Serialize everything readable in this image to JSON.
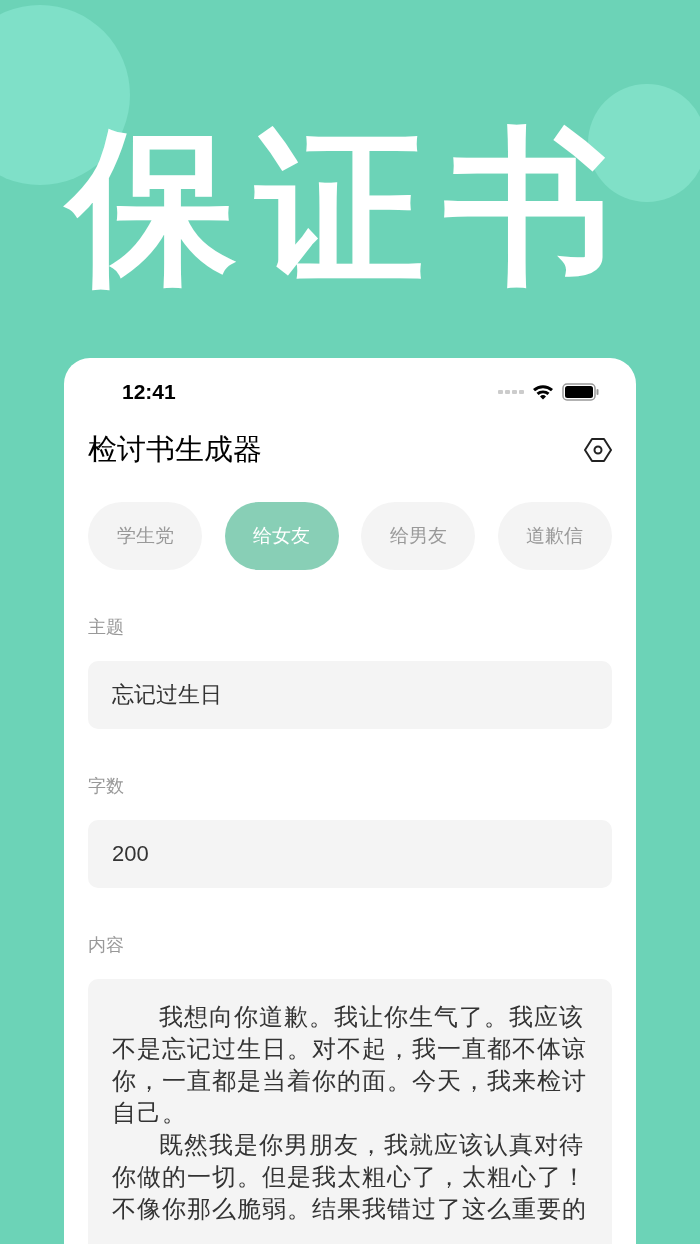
{
  "hero_title": "保证书",
  "status_bar": {
    "time": "12:41"
  },
  "app_bar": {
    "title": "检讨书生成器"
  },
  "tabs": [
    {
      "label": "学生党",
      "selected": false
    },
    {
      "label": "给女友",
      "selected": true
    },
    {
      "label": "给男友",
      "selected": false
    },
    {
      "label": "道歉信",
      "selected": false
    }
  ],
  "fields": [
    {
      "label": "主题",
      "value": "忘记过生日"
    },
    {
      "label": "字数",
      "value": "200"
    }
  ],
  "content": {
    "label": "内容",
    "paragraphs": [
      "我想向你道歉。我让你生气了。我应该不是忘记过生日。对不起，我一直都不体谅你，一直都是当着你的面。今天，我来检讨自己。",
      "既然我是你男朋友，我就应该认真对待你做的一切。但是我太粗心了，太粗心了！不像你那么脆弱。结果我错过了这么重要的"
    ]
  }
}
